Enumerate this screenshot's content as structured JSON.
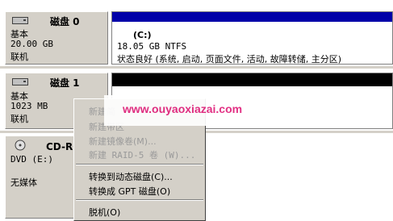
{
  "disks": [
    {
      "name": "磁盘 0",
      "type": "基本",
      "size": "20.00 GB",
      "status": "联机",
      "volume": {
        "drive": "(C:)",
        "size_fs": "18.05 GB NTFS",
        "status": "状态良好 (系统, 启动, 页面文件, 活动, 故障转储, 主分区)"
      }
    },
    {
      "name": "磁盘 1",
      "type": "基本",
      "size": "1023 MB",
      "status": "联机"
    },
    {
      "name": "CD-RO",
      "type": "DVD (E:)",
      "status": "无媒体"
    }
  ],
  "context_menu": {
    "items": [
      {
        "label": "新建简",
        "enabled": false
      },
      {
        "label": "新建带区",
        "enabled": false
      },
      {
        "label": "新建镜像卷(M)...",
        "enabled": false
      },
      {
        "label": "新建 RAID-5 卷 (W)...",
        "enabled": false
      },
      {
        "label": "转换到动态磁盘(C)...",
        "enabled": true
      },
      {
        "label": "转换成 GPT 磁盘(O)",
        "enabled": true
      },
      {
        "label": "脱机(O)",
        "enabled": true
      }
    ]
  },
  "watermark": "www.ouyaoxiazai.com",
  "colors": {
    "primary_partition_bar": "#0000a8",
    "unallocated_bar": "#000000",
    "panel_bg": "#d4d0c8",
    "watermark": "#e0207a"
  }
}
